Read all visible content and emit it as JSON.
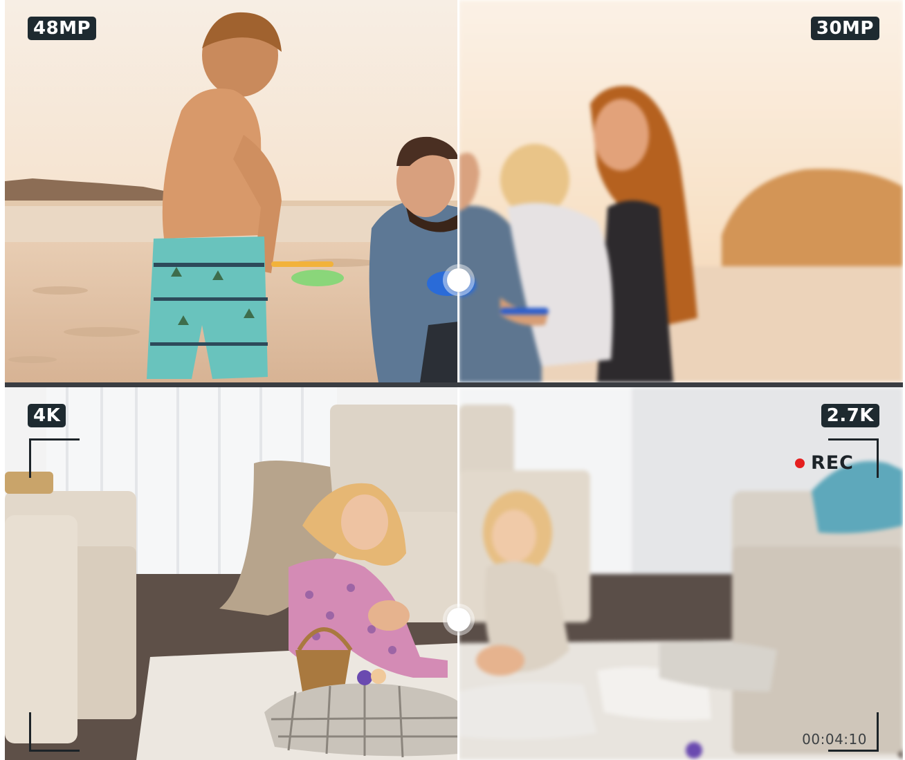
{
  "top_comparison": {
    "left_badge": "48MP",
    "right_badge": "30MP"
  },
  "bottom_comparison": {
    "left_badge": "4K",
    "right_badge": "2.7K",
    "recording": {
      "label": "REC",
      "timecode": "00:04:10"
    }
  },
  "colors": {
    "badge_bg": "#1e2a30",
    "badge_text": "#ffffff",
    "rec_dot": "#e51f1f",
    "viewfinder_frame": "#1c2328",
    "divider_band": "#3a3d42"
  },
  "icons": {
    "split_handle": "circle-handle-icon",
    "record": "record-dot-icon"
  }
}
